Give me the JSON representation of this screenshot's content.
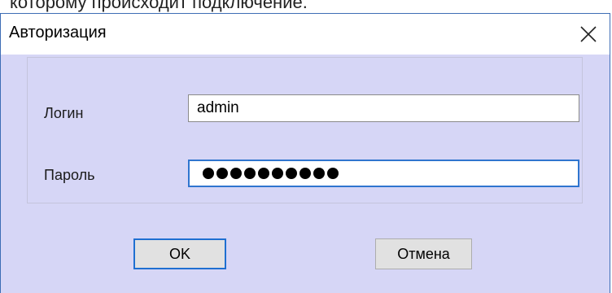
{
  "top_caption": "которому происходит подключение.",
  "dialog": {
    "title": "Авторизация",
    "close_icon": "close-icon"
  },
  "form": {
    "login_label": "Логин",
    "login_value": "admin",
    "password_label": "Пароль",
    "password_mask_length": 10
  },
  "buttons": {
    "ok_label": "OK",
    "cancel_label": "Отмена"
  },
  "colors": {
    "dialog_bg": "#d6d6f6",
    "focus_border": "#2f75cf",
    "button_bg": "#e1e1e1"
  }
}
